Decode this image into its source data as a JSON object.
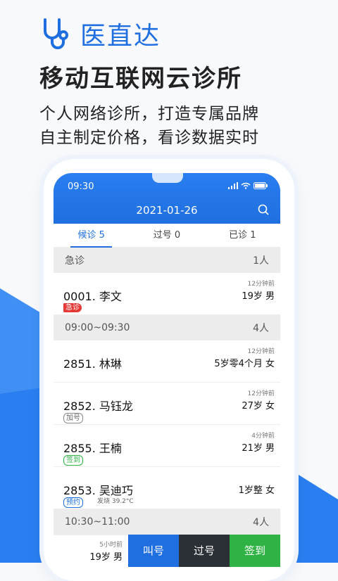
{
  "brand": {
    "name": "医直达"
  },
  "headline": "移动互联网云诊所",
  "subtitle1": "个人网络诊所，打造专属品牌",
  "subtitle2": "自主制定价格，看诊数据实时",
  "phone": {
    "time": "09:30",
    "date": "2021-01-26",
    "tabs": [
      "候诊 5",
      "过号 0",
      "已诊 1"
    ],
    "sections": [
      {
        "name": "急诊",
        "count": "1人"
      },
      {
        "name": "09:00~09:30",
        "count": "4人"
      },
      {
        "name": "10:30~11:00",
        "count": "4人"
      }
    ],
    "rows": [
      {
        "id": "0001.",
        "name": "李文",
        "time": "12分钟前",
        "age": "19岁  男",
        "badge": "急诊"
      },
      {
        "id": "2851.",
        "name": "林琳",
        "time": "12分钟前",
        "age": "5岁零4个月  女"
      },
      {
        "id": "2852.",
        "name": "马钰龙",
        "time": "12分钟前",
        "age": "27岁  女",
        "badge": "加号"
      },
      {
        "id": "2855.",
        "name": "王楠",
        "time": "4分钟前",
        "age": "21岁  男",
        "badge": "签到"
      },
      {
        "id": "2853.",
        "name": "吴迪巧",
        "time": "",
        "age": "1岁整  女",
        "badge": "预约",
        "note": "发烧 39.2°C"
      }
    ],
    "bottom": {
      "time": "5小时前",
      "age": "19岁  男",
      "buttons": [
        {
          "label": "叫号",
          "color": "#1f6fe0"
        },
        {
          "label": "过号",
          "color": "#2b2f36"
        },
        {
          "label": "签到",
          "color": "#2fb344"
        }
      ]
    }
  }
}
